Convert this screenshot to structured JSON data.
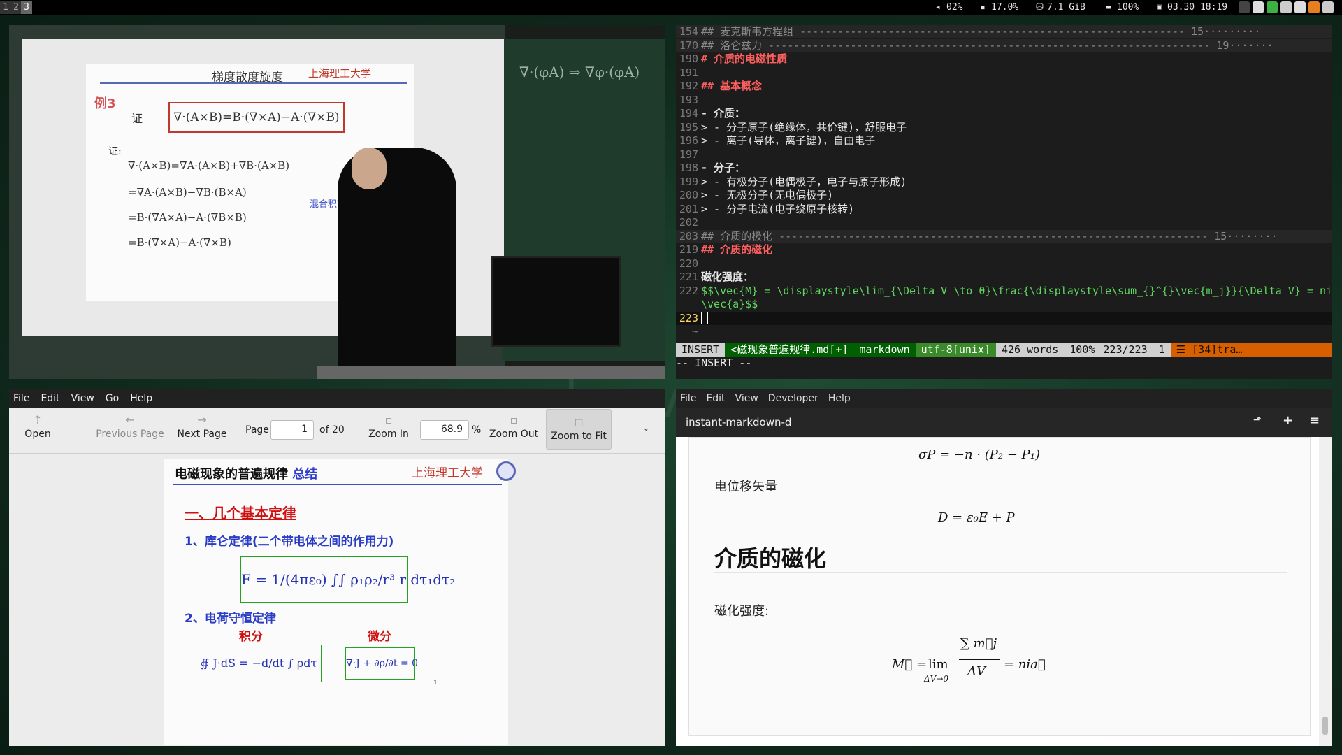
{
  "topbar": {
    "workspaces": [
      "1",
      "2",
      "3"
    ],
    "active_workspace": "3",
    "cpu": "02%",
    "mem_pct": "17.0%",
    "mem_free": "7.1 GiB",
    "battery": "100%",
    "datetime": "03.30 18:19"
  },
  "video": {
    "slide_title": "梯度散度旋度",
    "slide_univ": "上海理工大学",
    "example_label": "例3",
    "proof_prefix": "证",
    "boxed_eq": "∇·(A×B)=B·(∇×A)−A·(∇×B)",
    "proof_label": "证:",
    "lines": [
      "∇·(A×B)=∇A·(A×B)+∇B·(A×B)",
      "=∇A·(A×B)−∇B·(B×A)",
      "=B·(∇A×A)−A·(∇B×B)",
      "=B·(∇×A)−A·(∇×B)"
    ],
    "annotation": "混合积轮",
    "chalk": "∇·(φA) ⇒ ∇φ·(φA)"
  },
  "vim": {
    "lines": [
      {
        "n": "154",
        "text": "## 麦克斯韦方程组 ------------------------------------------------------------- 15·········",
        "kind": "fold"
      },
      {
        "n": "170",
        "text": "## 洛仑兹力 ---------------------------------------------------------------------- 19·······",
        "kind": "fold"
      },
      {
        "n": "190",
        "text": "# 介质的电磁性质",
        "kind": "h1"
      },
      {
        "n": "191",
        "text": "",
        "kind": "plain"
      },
      {
        "n": "192",
        "text": "## 基本概念",
        "kind": "h2"
      },
      {
        "n": "193",
        "text": "",
        "kind": "plain"
      },
      {
        "n": "194",
        "text": "- 介质：",
        "kind": "list"
      },
      {
        "n": "195",
        "text": "> - 分子原子(绝缘体，共价键)，舒服电子",
        "kind": "quote"
      },
      {
        "n": "196",
        "text": "> - 离子(导体，离子键)，自由电子",
        "kind": "quote"
      },
      {
        "n": "197",
        "text": "",
        "kind": "plain"
      },
      {
        "n": "198",
        "text": "- 分子：",
        "kind": "list"
      },
      {
        "n": "199",
        "text": "> - 有极分子(电偶极子，电子与原子形成)",
        "kind": "quote"
      },
      {
        "n": "200",
        "text": "> - 无极分子(无电偶极子)",
        "kind": "quote"
      },
      {
        "n": "201",
        "text": "> - 分子电流(电子绕原子核转)",
        "kind": "quote"
      },
      {
        "n": "202",
        "text": "",
        "kind": "plain"
      },
      {
        "n": "203",
        "text": "## 介质的极化 -------------------------------------------------------------------- 15········",
        "kind": "fold"
      },
      {
        "n": "219",
        "text": "## 介质的磁化",
        "kind": "h2"
      },
      {
        "n": "220",
        "text": "",
        "kind": "plain"
      },
      {
        "n": "221",
        "text": "磁化强度：",
        "kind": "bold"
      },
      {
        "n": "222",
        "text": "$$\\vec{M} = \\displaystyle\\lim_{\\Delta V \\to 0}\\frac{\\displaystyle\\sum_{}^{}\\vec{m_j}}{\\Delta V} = ni",
        "kind": "math"
      },
      {
        "n": "",
        "text": "\\vec{a}$$",
        "kind": "math"
      },
      {
        "n": "223",
        "text": "",
        "kind": "cursor"
      },
      {
        "n": "~",
        "text": "",
        "kind": "tilde"
      },
      {
        "n": "~",
        "text": "",
        "kind": "tilde"
      }
    ],
    "status": {
      "mode": "INSERT",
      "file": "<磁现象普遍规律.md[+]",
      "filetype": "markdown",
      "encoding": "utf-8[unix]",
      "words": "426 words",
      "percent": "100%",
      "position": "223/223",
      "col": "1",
      "extra": "☰ [34]tra…"
    },
    "cmdline": "-- INSERT --"
  },
  "evince": {
    "menu": [
      "File",
      "Edit",
      "View",
      "Go",
      "Help"
    ],
    "toolbar": {
      "open": "Open",
      "prev": "Previous Page",
      "next": "Next Page",
      "page_label": "Page",
      "page_value": "1",
      "page_of": "of 20",
      "zoom_in": "Zoom In",
      "zoom_value": "68.9",
      "zoom_pct": "%",
      "zoom_out": "Zoom Out",
      "zoom_fit": "Zoom to Fit"
    },
    "page": {
      "title": "电磁现象的普遍规律",
      "title_tag": "总结",
      "univ": "上海理工大学",
      "h1": "一、几个基本定律",
      "law1": "1、库仑定律(二个带电体之间的作用力)",
      "eq1": "F = 1/(4πε₀) ∫∫ ρ₁ρ₂/r³ r dτ₁dτ₂",
      "law2": "2、电荷守恒定律",
      "integral_label": "积分",
      "diff_label": "微分",
      "eq2": "∯ J·dS = −d/dt ∫ ρdτ",
      "eq3": "∇·J + ∂ρ/∂t = 0",
      "page_no": "1"
    }
  },
  "preview": {
    "menu": [
      "File",
      "Edit",
      "View",
      "Developer",
      "Help"
    ],
    "title": "instant-markdown-d",
    "eq_sigma": "σP = −n · (P₂ − P₁)",
    "text_d": "电位移矢量",
    "eq_d": "D = ε₀E + P",
    "heading": "介质的磁化",
    "text_m": "磁化强度:",
    "eq_m": "M = lim ΔV→0 Σm_j / ΔV = nia",
    "eq_m_lim": "lim",
    "eq_m_sub": "ΔV→0",
    "eq_m_num": "∑ m⃗j",
    "eq_m_den": "ΔV",
    "eq_m_left": "M⃗ =",
    "eq_m_right": "= nia⃗"
  },
  "colors": {
    "vim_green": "#5fd75f",
    "vim_red": "#ff5f5f",
    "vim_yellow": "#ffd75f",
    "status_insert": "#005f00"
  }
}
